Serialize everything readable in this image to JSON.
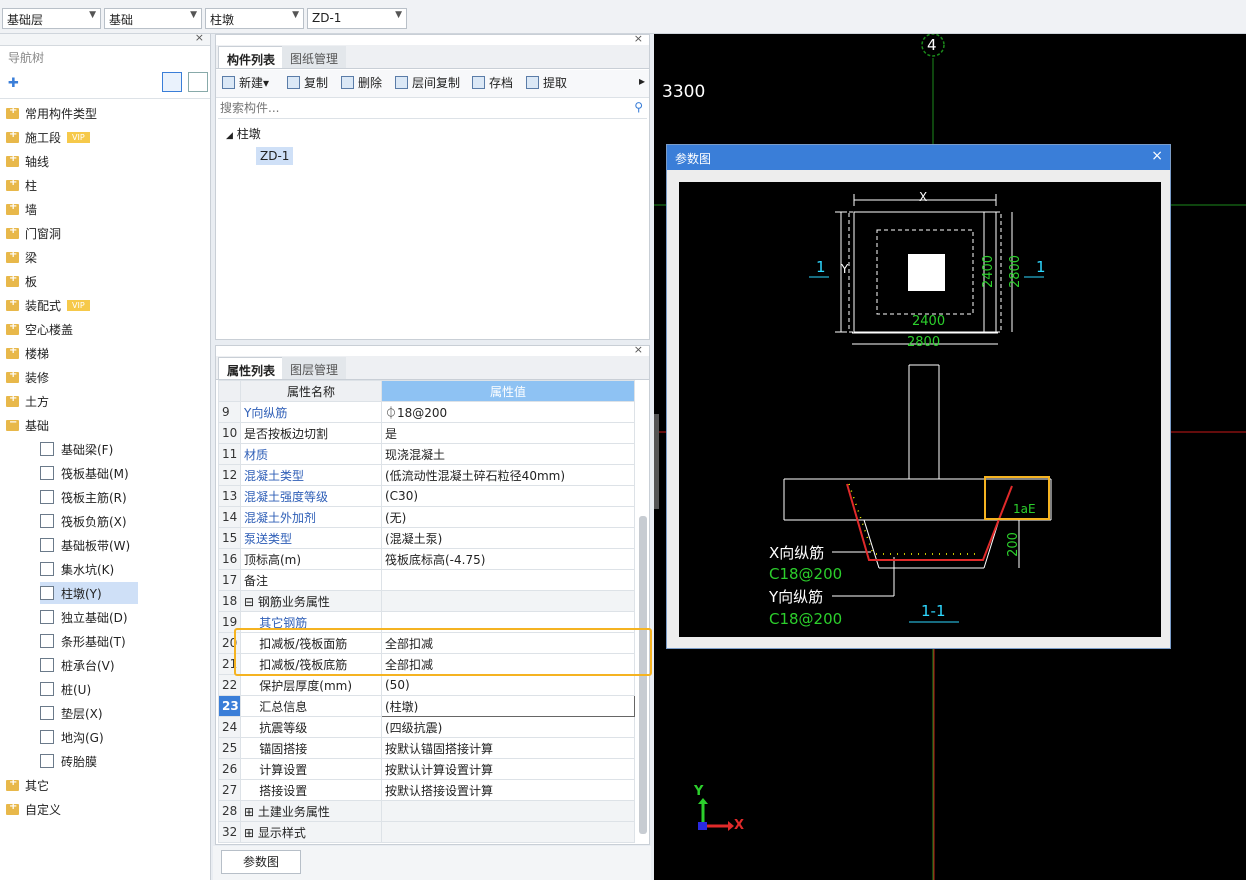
{
  "toolbar": {
    "floor": "基础层",
    "category": "基础",
    "type": "柱墩",
    "component": "ZD-1"
  },
  "nav": {
    "title": "导航树",
    "items": [
      {
        "label": "常用构件类型",
        "vip": false
      },
      {
        "label": "施工段",
        "vip": true
      },
      {
        "label": "轴线",
        "vip": false
      },
      {
        "label": "柱",
        "vip": false
      },
      {
        "label": "墙",
        "vip": false
      },
      {
        "label": "门窗洞",
        "vip": false
      },
      {
        "label": "梁",
        "vip": false
      },
      {
        "label": "板",
        "vip": false
      },
      {
        "label": "装配式",
        "vip": true
      },
      {
        "label": "空心楼盖",
        "vip": false
      },
      {
        "label": "楼梯",
        "vip": false
      },
      {
        "label": "装修",
        "vip": false
      },
      {
        "label": "土方",
        "vip": false
      },
      {
        "label": "基础",
        "vip": false
      }
    ],
    "vip_label": "VIP",
    "sub": [
      "基础梁(F)",
      "筏板基础(M)",
      "筏板主筋(R)",
      "筏板负筋(X)",
      "基础板带(W)",
      "集水坑(K)",
      "柱墩(Y)",
      "独立基础(D)",
      "条形基础(T)",
      "桩承台(V)",
      "桩(U)",
      "垫层(X)",
      "地沟(G)",
      "砖胎膜"
    ],
    "tail": [
      "其它",
      "自定义"
    ]
  },
  "comp": {
    "tab1": "构件列表",
    "tab2": "图纸管理",
    "tools": [
      "新建",
      "复制",
      "删除",
      "层间复制",
      "存档",
      "提取"
    ],
    "search_placeholder": "搜索构件...",
    "group": "柱墩",
    "item": "ZD-1"
  },
  "props": {
    "tab1": "属性列表",
    "tab2": "图层管理",
    "h_name": "属性名称",
    "h_val": "属性值",
    "rows": [
      {
        "n": "9",
        "name": "Y向纵筋",
        "val": "⏀18@200",
        "blue": true
      },
      {
        "n": "10",
        "name": "是否按板边切割",
        "val": "是",
        "blue": false
      },
      {
        "n": "11",
        "name": "材质",
        "val": "现浇混凝土",
        "blue": true
      },
      {
        "n": "12",
        "name": "混凝土类型",
        "val": "(低流动性混凝土碎石粒径40mm)",
        "blue": true
      },
      {
        "n": "13",
        "name": "混凝土强度等级",
        "val": "(C30)",
        "blue": true
      },
      {
        "n": "14",
        "name": "混凝土外加剂",
        "val": "(无)",
        "blue": true
      },
      {
        "n": "15",
        "name": "泵送类型",
        "val": "(混凝土泵)",
        "blue": true
      },
      {
        "n": "16",
        "name": "顶标高(m)",
        "val": "筏板底标高(-4.75)",
        "blue": false
      },
      {
        "n": "17",
        "name": "备注",
        "val": "",
        "blue": false
      },
      {
        "n": "18",
        "name": "⊟ 钢筋业务属性",
        "val": "",
        "blue": false
      },
      {
        "n": "19",
        "name": "    其它钢筋",
        "val": "",
        "blue": true
      },
      {
        "n": "20",
        "name": "    扣减板/筏板面筋",
        "val": "全部扣减",
        "blue": false
      },
      {
        "n": "21",
        "name": "    扣减板/筏板底筋",
        "val": "全部扣减",
        "blue": false
      },
      {
        "n": "22",
        "name": "    保护层厚度(mm)",
        "val": "(50)",
        "blue": false
      },
      {
        "n": "23",
        "name": "    汇总信息",
        "val": "(柱墩)",
        "blue": false
      },
      {
        "n": "24",
        "name": "    抗震等级",
        "val": "(四级抗震)",
        "blue": false
      },
      {
        "n": "25",
        "name": "    锚固搭接",
        "val": "按默认锚固搭接计算",
        "blue": false
      },
      {
        "n": "26",
        "name": "    计算设置",
        "val": "按默认计算设置计算",
        "blue": false
      },
      {
        "n": "27",
        "name": "    搭接设置",
        "val": "按默认搭接设置计算",
        "blue": false
      },
      {
        "n": "28",
        "name": "⊞ 土建业务属性",
        "val": "",
        "blue": false
      },
      {
        "n": "32",
        "name": "⊞ 显示样式",
        "val": "",
        "blue": false
      }
    ]
  },
  "bottom_btn": "参数图",
  "cad": {
    "axis": "4",
    "dim": "3300",
    "dialog_title": "参数图",
    "drawing": {
      "x": "X",
      "y": "Y",
      "d2400": "2400",
      "d2800": "2800",
      "sec": "1",
      "lae": "1aE",
      "d200": "200",
      "xbar": "X向纵筋",
      "xspec": "C18@200",
      "ybar": "Y向纵筋",
      "yspec": "C18@200",
      "section": "1-1"
    },
    "ucs_x": "X",
    "ucs_y": "Y"
  }
}
